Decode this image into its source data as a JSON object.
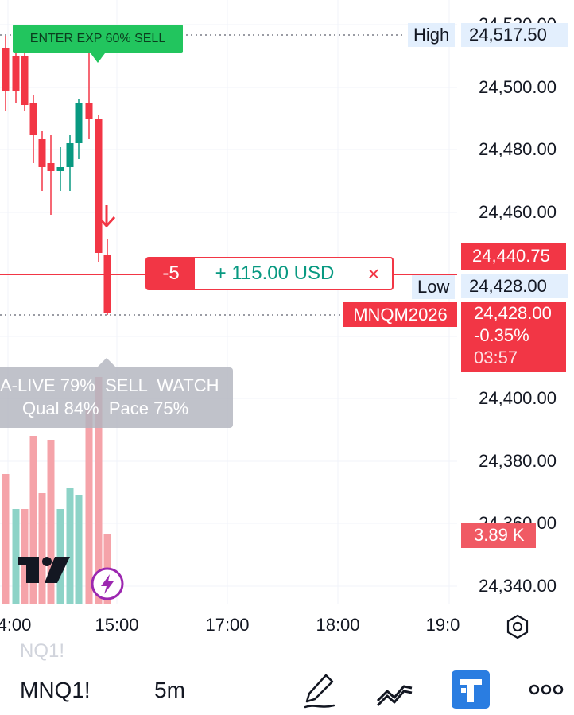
{
  "price_axis": {
    "ticks": [
      "24,520.00",
      "24,500.00",
      "24,480.00",
      "24,460.00",
      "24,400.00",
      "24,380.00",
      "24,360.00",
      "24,340.00"
    ]
  },
  "time_axis": {
    "ticks": [
      "4:00",
      "15:00",
      "17:00",
      "18:00",
      "19:0"
    ]
  },
  "high_marker": {
    "label": "High",
    "value": "24,517.50"
  },
  "low_marker": {
    "label": "Low",
    "value": "24,428.00"
  },
  "position_price": "24,440.75",
  "symbol_tag": {
    "symbol": "MNQM2026",
    "price": "24,428.00",
    "change": "-0.35%",
    "countdown": "03:57"
  },
  "volume_tag": "3.89 K",
  "signal_label": "ENTER EXP 60% SELL",
  "order": {
    "quantity": "-5",
    "pnl": "+ 115.00 USD",
    "close": "×"
  },
  "indicator_overlay": {
    "line1": "A-LIVE 79%  SELL  WATCH",
    "line2": "Qual 84%  Pace 75%"
  },
  "bottom_bar": {
    "ghost_symbol": "NQ1!",
    "symbol": "MNQ1!",
    "interval": "5m",
    "icons": [
      "pencil-icon",
      "trendline-icon",
      "app-icon",
      "more-icon"
    ]
  },
  "colors": {
    "up": "#089981",
    "down": "#f23645",
    "signal": "#22c55e"
  }
}
